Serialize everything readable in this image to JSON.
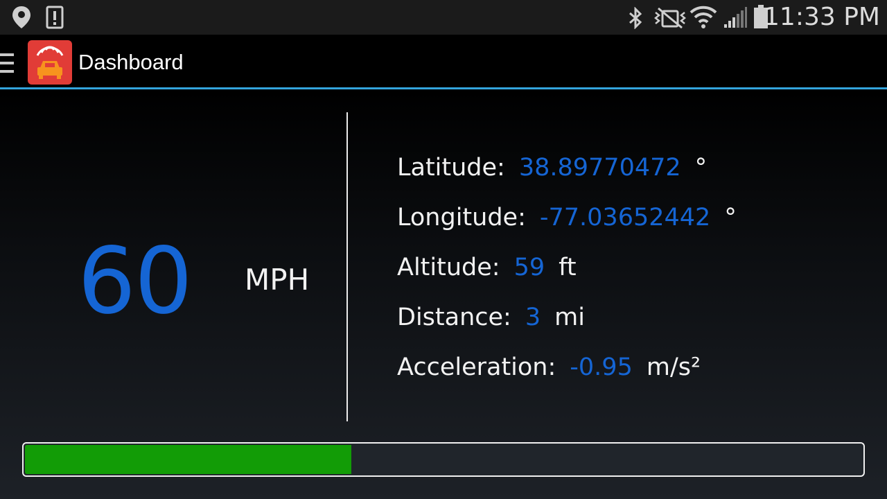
{
  "status_bar": {
    "time": "11:33 PM",
    "icons": [
      "location-pin-icon",
      "alert-notification-icon",
      "bluetooth-icon",
      "vibrate-mute-icon",
      "wifi-icon",
      "signal-icon",
      "battery-icon"
    ]
  },
  "action_bar": {
    "title": "Dashboard",
    "menu_icon": "hamburger-menu-icon",
    "app_icon": "car-radar-app-icon",
    "divider_color": "#33a5dd"
  },
  "speed": {
    "value": "60",
    "unit": "MPH"
  },
  "stats": [
    {
      "label": "Latitude:",
      "value": "38.89770472",
      "unit": "°"
    },
    {
      "label": "Longitude:",
      "value": "-77.03652442",
      "unit": "°"
    },
    {
      "label": "Altitude:",
      "value": "59",
      "unit": "ft"
    },
    {
      "label": "Distance:",
      "value": "3",
      "unit": "mi"
    },
    {
      "label": "Acceleration:",
      "value": "-0.95",
      "unit": "m/s²"
    }
  ],
  "progress": {
    "fraction": 0.39
  },
  "colors": {
    "accent_blue": "#1565d4",
    "progress_green": "#129c06",
    "app_icon_red": "#e13c37",
    "app_icon_orange": "#f7931e"
  }
}
